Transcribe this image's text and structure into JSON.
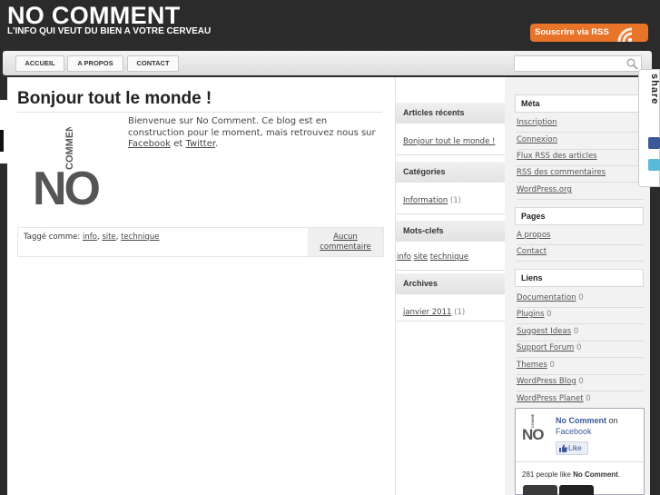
{
  "header": {
    "site_title": "NO COMMENT",
    "tagline": "L'INFO QUI VEUT DU BIEN A VOTRE CERVEAU",
    "rss_label": "Souscrire via RSS"
  },
  "nav": {
    "items": [
      "ACCUEIL",
      "A PROPOS",
      "CONTACT"
    ],
    "search_placeholder": ""
  },
  "post": {
    "title": "Bonjour tout le monde !",
    "body_text": "Bienvenue sur No Comment. Ce blog est en construction pour le moment, mais retrouvez nous sur",
    "facebook_link": "Facebook",
    "and": "et",
    "twitter_link": "Twitter",
    "tags_label": "Taggé comme:",
    "tags": [
      "info",
      "site",
      "technique"
    ],
    "comments_line1": "Aucun",
    "comments_line2": "commentaire"
  },
  "middle": {
    "recent_title": "Articles récents",
    "recent_item": "Bonjour tout le monde !",
    "categories_title": "Catégories",
    "category_item": "Information",
    "category_count": "(1)",
    "tags_title": "Mots-clefs",
    "tags": [
      "info",
      "site",
      "technique"
    ],
    "archives_title": "Archives",
    "archive_item": "janvier 2011",
    "archive_count": "(1)"
  },
  "right": {
    "meta_title": "Méta",
    "meta_items": [
      "Inscription",
      "Connexion",
      "Flux RSS des articles",
      "RSS des commentaires",
      "WordPress.org"
    ],
    "pages_title": "Pages",
    "pages_items": [
      "A propos",
      "Contact"
    ],
    "links_title": "Liens",
    "links_items": [
      {
        "label": "Documentation",
        "count": "0"
      },
      {
        "label": "Plugins",
        "count": "0"
      },
      {
        "label": "Suggest Ideas",
        "count": "0"
      },
      {
        "label": "Support Forum",
        "count": "0"
      },
      {
        "label": "Themes",
        "count": "0"
      },
      {
        "label": "WordPress Blog",
        "count": "0"
      },
      {
        "label": "WordPress Planet",
        "count": "0"
      }
    ]
  },
  "facebook": {
    "page_name": "No Comment",
    "on": "on",
    "platform": "Facebook",
    "like_label": "Like",
    "count_prefix": "281 people like",
    "count_name": "No Comment",
    "count_suffix": "."
  },
  "share": {
    "label": "share"
  },
  "colors": {
    "header_bg": "#2b2b2b",
    "rss_orange": "#e8742a",
    "facebook_blue": "#3b5998"
  },
  "icons": [
    "rss-icon",
    "search-icon",
    "no-comment-logo",
    "facebook-icon",
    "twitter-icon"
  ]
}
